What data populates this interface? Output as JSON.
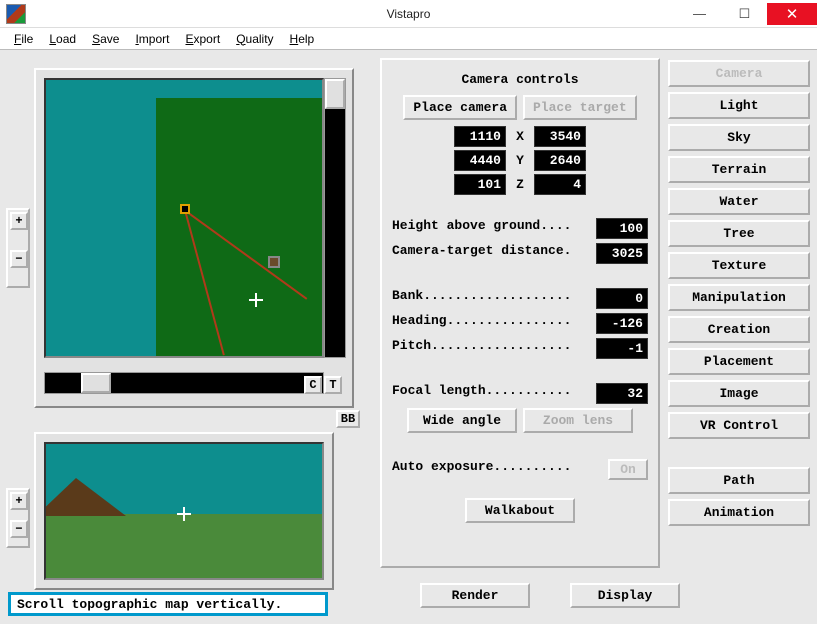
{
  "app": {
    "title": "Vistapro"
  },
  "menu": {
    "file": "File",
    "load": "Load",
    "save": "Save",
    "import": "Import",
    "export": "Export",
    "quality": "Quality",
    "help": "Help"
  },
  "topo": {
    "c": "C",
    "t": "T",
    "bb": "BB",
    "plus": "+",
    "minus": "−"
  },
  "status": "Scroll topographic map vertically.",
  "panel": {
    "title": "Camera controls",
    "place_camera": "Place camera",
    "place_target": "Place target",
    "coords": {
      "x_lbl": "X",
      "y_lbl": "Y",
      "z_lbl": "Z",
      "cam_x": "1110",
      "cam_y": "4440",
      "cam_z": "101",
      "tgt_x": "3540",
      "tgt_y": "2640",
      "tgt_z": "4"
    },
    "hag_label": "Height above ground....",
    "hag": "100",
    "dist_label": "Camera-target distance.",
    "dist": "3025",
    "bank_label": "Bank...................",
    "bank": "0",
    "heading_label": "Heading................",
    "heading": "-126",
    "pitch_label": "Pitch..................",
    "pitch": "-1",
    "focal_label": "Focal length...........",
    "focal": "32",
    "wide": "Wide angle",
    "zoom": "Zoom lens",
    "auto_exp_label": "Auto exposure..........",
    "auto_exp": "On",
    "walkabout": "Walkabout"
  },
  "side": {
    "camera": "Camera",
    "light": "Light",
    "sky": "Sky",
    "terrain": "Terrain",
    "water": "Water",
    "tree": "Tree",
    "texture": "Texture",
    "manipulation": "Manipulation",
    "creation": "Creation",
    "placement": "Placement",
    "image": "Image",
    "vr": "VR Control",
    "path": "Path",
    "animation": "Animation"
  },
  "bottom": {
    "render": "Render",
    "display": "Display"
  }
}
